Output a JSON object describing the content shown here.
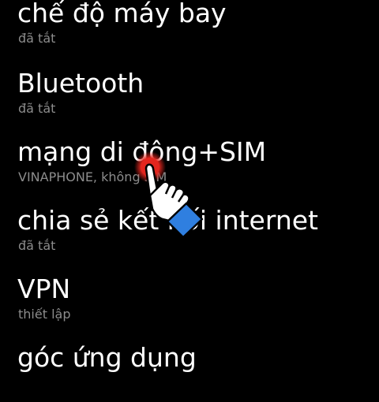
{
  "settings": {
    "items": [
      {
        "title": "chế độ máy bay",
        "status": "đã tắt"
      },
      {
        "title": "Bluetooth",
        "status": "đã tắt"
      },
      {
        "title": "mạng di động+SIM",
        "status": "VINAPHONE, không SIM"
      },
      {
        "title": "chia sẻ kết nối internet",
        "status": "đã tắt"
      },
      {
        "title": "VPN",
        "status": "thiết lập"
      },
      {
        "title": "góc ứng dụng",
        "status": ""
      }
    ]
  },
  "overlay": {
    "icon": "tap-hand-icon",
    "pointer_color": "#e3261e",
    "cuff_color": "#2f7fe0"
  }
}
